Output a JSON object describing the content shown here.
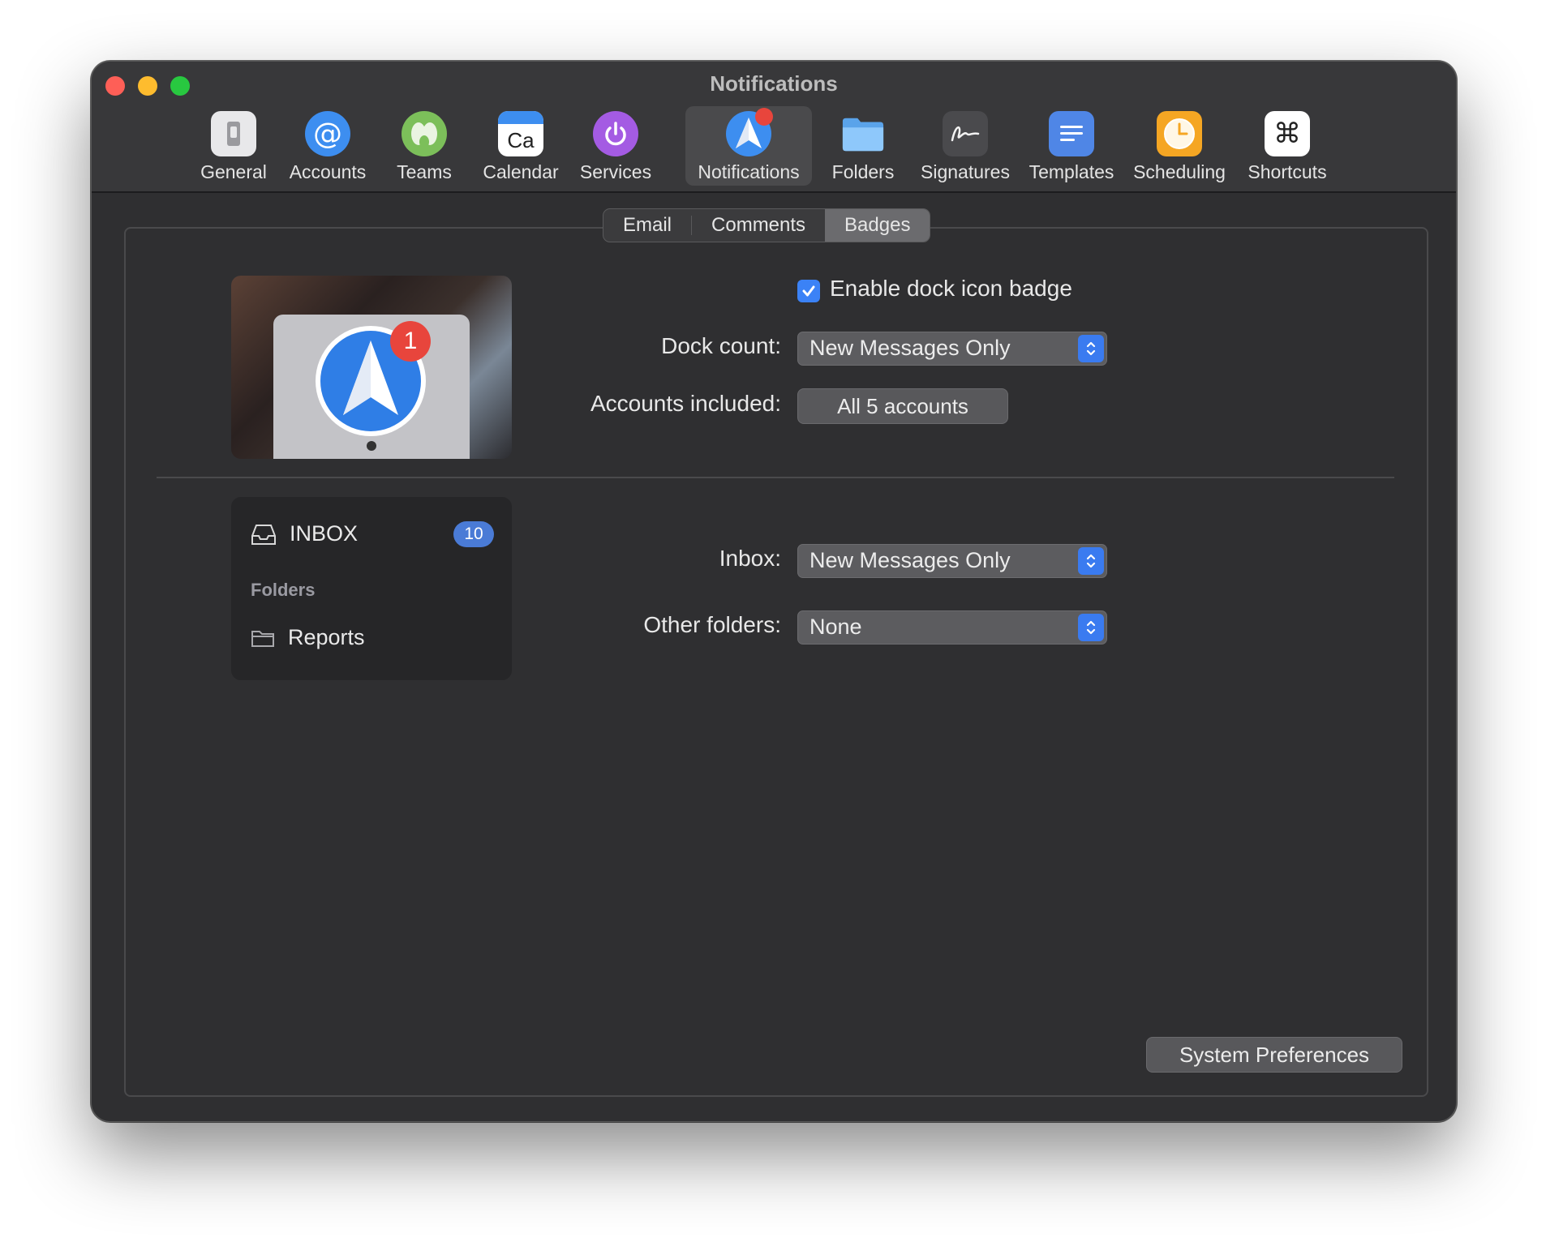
{
  "window": {
    "title": "Notifications"
  },
  "toolbar": {
    "items": [
      {
        "label": "General",
        "icon": "general-icon"
      },
      {
        "label": "Accounts",
        "icon": "at-sign-icon"
      },
      {
        "label": "Teams",
        "icon": "teams-icon"
      },
      {
        "label": "Calendar",
        "icon": "calendar-icon",
        "icon_text": "Ca"
      },
      {
        "label": "Services",
        "icon": "power-icon"
      },
      {
        "label": "Notifications",
        "icon": "spark-logo-icon",
        "selected": true
      },
      {
        "label": "Folders",
        "icon": "folder-icon"
      },
      {
        "label": "Signatures",
        "icon": "signature-icon"
      },
      {
        "label": "Templates",
        "icon": "template-icon"
      },
      {
        "label": "Scheduling",
        "icon": "clock-icon"
      },
      {
        "label": "Shortcuts",
        "icon": "command-icon",
        "icon_text": "⌘"
      }
    ]
  },
  "tabs": [
    {
      "label": "Email"
    },
    {
      "label": "Comments"
    },
    {
      "label": "Badges",
      "selected": true
    }
  ],
  "badges": {
    "dock_preview_badge": "1",
    "enable_dock_badge": {
      "label": "Enable dock icon badge",
      "checked": true
    },
    "dock_count": {
      "label": "Dock count:",
      "value": "New Messages Only"
    },
    "accounts_included": {
      "label": "Accounts included:",
      "button": "All 5 accounts"
    },
    "mailbox": {
      "inbox_label": "INBOX",
      "inbox_count": "10",
      "section_label": "Folders",
      "folder_label": "Reports"
    },
    "inbox": {
      "label": "Inbox:",
      "value": "New Messages Only"
    },
    "other_folders": {
      "label": "Other folders:",
      "value": "None"
    },
    "system_preferences_button": "System Preferences"
  },
  "colors": {
    "accent": "#3b82f6",
    "window_bg": "#2f2f31",
    "badge_red": "#e8453c"
  }
}
